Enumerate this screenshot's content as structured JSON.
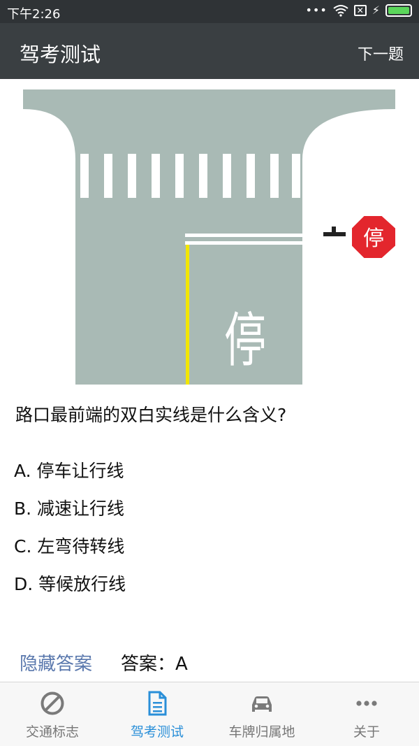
{
  "status_bar": {
    "time": "下午2:26",
    "signal_dots": "•••"
  },
  "app_bar": {
    "title": "驾考测试",
    "next_label": "下一题"
  },
  "illustration": {
    "road_marking_text": "停",
    "sign_text": "停",
    "sign_color": "#e3262d",
    "road_color": "#a9bab5",
    "edge_line_color": "#f2e600"
  },
  "quiz": {
    "question": "路口最前端的双白实线是什么含义?",
    "options": [
      {
        "label": "A. 停车让行线"
      },
      {
        "label": "B. 减速让行线"
      },
      {
        "label": "C. 左弯待转线"
      },
      {
        "label": "D. 等候放行线"
      }
    ],
    "hide_answer_label": "隐藏答案",
    "answer_text": "答案：A"
  },
  "bottom_nav": {
    "items": [
      {
        "label": "交通标志",
        "icon": "no-entry-icon"
      },
      {
        "label": "驾考测试",
        "icon": "document-icon",
        "active": true
      },
      {
        "label": "车牌归属地",
        "icon": "car-icon"
      },
      {
        "label": "关于",
        "icon": "more-icon"
      }
    ],
    "active_color": "#2a8fd8"
  }
}
